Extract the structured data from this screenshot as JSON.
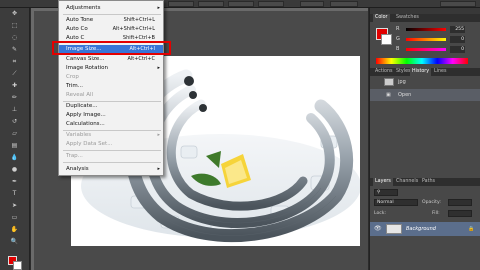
{
  "image_menu": {
    "items": [
      {
        "label": "Adjustments",
        "shortcut": "",
        "submenu": true,
        "disabled": false
      },
      {
        "label": "Auto Tone",
        "shortcut": "Shift+Ctrl+L",
        "submenu": false,
        "disabled": false
      },
      {
        "label": "Auto Co",
        "shortcut": "Alt+Shift+Ctrl+L",
        "submenu": false,
        "disabled": false
      },
      {
        "label": "Auto C",
        "shortcut": "Shift+Ctrl+B",
        "submenu": false,
        "disabled": false
      },
      {
        "label": "Image Size...",
        "shortcut": "Alt+Ctrl+I",
        "submenu": false,
        "disabled": false,
        "highlighted": true
      },
      {
        "label": "Canvas Size...",
        "shortcut": "Alt+Ctrl+C",
        "submenu": false,
        "disabled": false
      },
      {
        "label": "Image Rotation",
        "shortcut": "",
        "submenu": true,
        "disabled": false
      },
      {
        "label": "Crop",
        "shortcut": "",
        "submenu": false,
        "disabled": true
      },
      {
        "label": "Trim...",
        "shortcut": "",
        "submenu": false,
        "disabled": false
      },
      {
        "label": "Reveal All",
        "shortcut": "",
        "submenu": false,
        "disabled": true
      },
      {
        "label": "Duplicate...",
        "shortcut": "",
        "submenu": false,
        "disabled": false
      },
      {
        "label": "Apply Image...",
        "shortcut": "",
        "submenu": false,
        "disabled": false
      },
      {
        "label": "Calculations...",
        "shortcut": "",
        "submenu": false,
        "disabled": false
      },
      {
        "label": "Variables",
        "shortcut": "",
        "submenu": true,
        "disabled": true
      },
      {
        "label": "Apply Data Set...",
        "shortcut": "",
        "submenu": false,
        "disabled": true
      },
      {
        "label": "Trap...",
        "shortcut": "",
        "submenu": false,
        "disabled": true
      },
      {
        "label": "Analysis",
        "shortcut": "",
        "submenu": true,
        "disabled": false
      }
    ]
  },
  "color_panel": {
    "tabs": [
      "Color",
      "Swatches"
    ],
    "channels": [
      {
        "label": "R",
        "value": "255"
      },
      {
        "label": "G",
        "value": "0"
      },
      {
        "label": "B",
        "value": "0"
      }
    ],
    "fg_color": "#e00000"
  },
  "history_panel": {
    "tabs": [
      "Actions",
      "Styles",
      "History",
      "Lines"
    ],
    "snapshot_label": "jpg",
    "items": [
      "Open"
    ]
  },
  "layers_panel": {
    "tabs": [
      "Layers",
      "Channels",
      "Paths"
    ],
    "blend_mode": "Normal",
    "opacity_label": "Opacity:",
    "lock_label": "Lock:",
    "fill_label": "Fill:",
    "layer_name": "Background"
  },
  "accent": "#3875d7"
}
